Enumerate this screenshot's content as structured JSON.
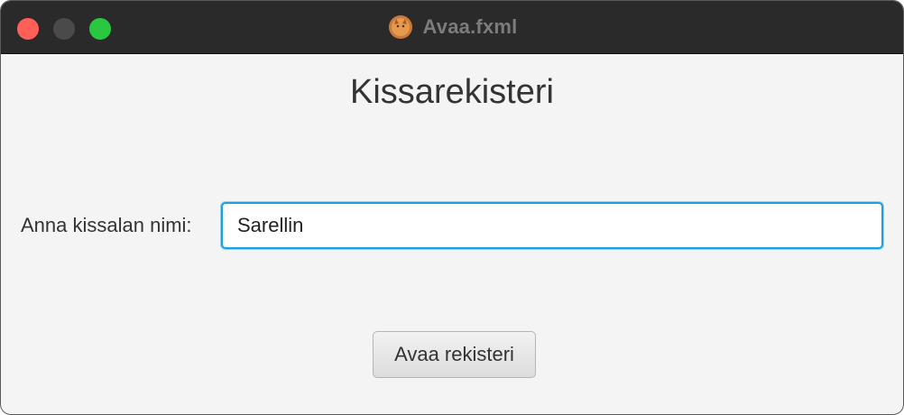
{
  "window": {
    "title": "Avaa.fxml",
    "app_icon": "cat-app-icon"
  },
  "main": {
    "heading": "Kissarekisteri",
    "name_label": "Anna kissalan nimi:",
    "name_value": "Sarellin",
    "open_button_label": "Avaa rekisteri"
  },
  "colors": {
    "titlebar": "#2a2a2a",
    "background": "#f4f4f4",
    "focus_accent": "#1f9fe0",
    "close": "#fe5f57",
    "zoom": "#28c840"
  }
}
